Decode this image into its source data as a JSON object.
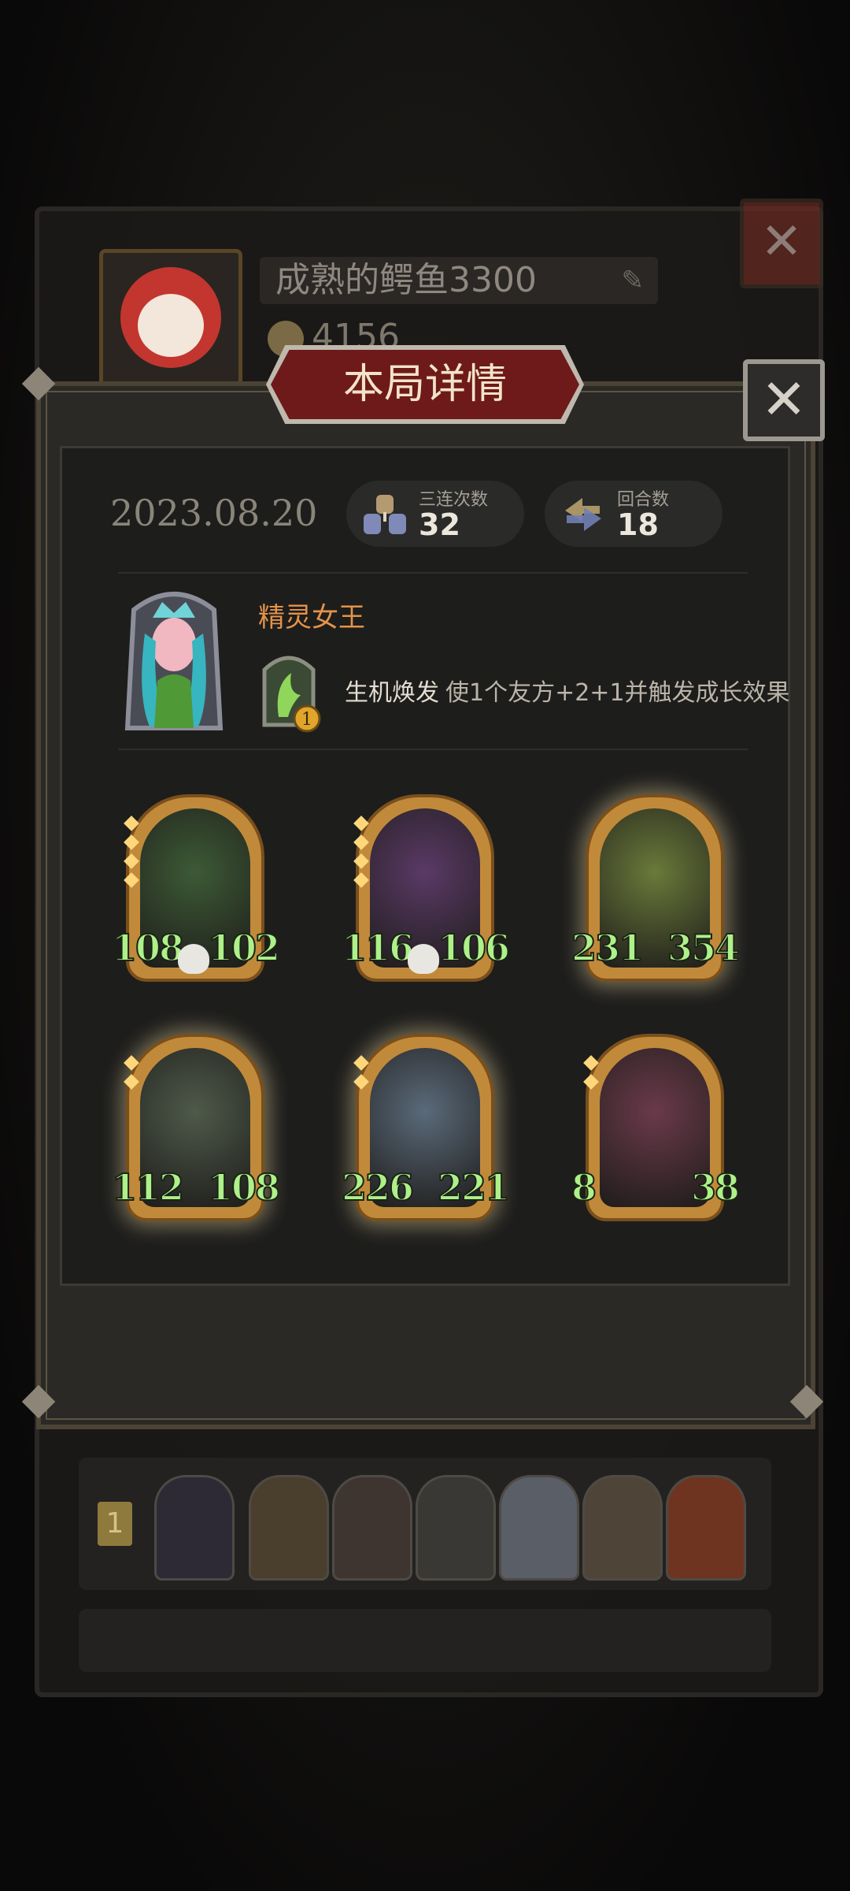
{
  "background": {
    "player_name": "成熟的鳄鱼3300",
    "coins": "4156",
    "close_label": "✕",
    "row_rank": "1"
  },
  "dialog": {
    "title": "本局详情",
    "close_label": "✕",
    "date": "2023.08.20",
    "stats": [
      {
        "label": "三连次数",
        "value": "32",
        "icon": "triple-merge-icon"
      },
      {
        "label": "回合数",
        "value": "18",
        "icon": "rounds-arrows-icon"
      }
    ],
    "hero": {
      "name": "精灵女王",
      "skill_name": "生机焕发",
      "skill_desc": "使1个友方+2+1并触发成长效果",
      "skill_cost": "1"
    },
    "cards": [
      {
        "name": "vine-crystal-plant",
        "attack": "108",
        "health": "102",
        "tier": 4,
        "skull": true,
        "glow": false,
        "art": "#3d5a36",
        "atk_disc": "#7a3fb0",
        "hp_disc": "#3a6aa8"
      },
      {
        "name": "flame-bulldog",
        "attack": "116",
        "health": "106",
        "tier": 4,
        "skull": true,
        "glow": false,
        "art": "#5a3a66",
        "atk_disc": "#335a7a",
        "hp_disc": "#7a3a3a"
      },
      {
        "name": "leaf-sprout-kid",
        "attack": "231",
        "health": "354",
        "tier": 0,
        "skull": false,
        "glow": true,
        "art": "#6a7a3a",
        "atk_disc": "#335a7a",
        "hp_disc": "#a33a4a"
      },
      {
        "name": "mushroom-spider",
        "attack": "112",
        "health": "108",
        "tier": 2,
        "skull": false,
        "glow": true,
        "art": "#4e5a4a",
        "atk_disc": "#335a7a",
        "hp_disc": "#b03a3a"
      },
      {
        "name": "armored-knight",
        "attack": "226",
        "health": "221",
        "tier": 2,
        "skull": false,
        "glow": true,
        "art": "#5a6a7a",
        "atk_disc": "#335a7a",
        "hp_disc": "#3a5a7a"
      },
      {
        "name": "jester-clown",
        "attack": "8",
        "health": "38",
        "tier": 2,
        "skull": false,
        "glow": false,
        "art": "#6a3a4a",
        "atk_disc": "#3a6aa8",
        "hp_disc": "#3a5a7a"
      }
    ]
  }
}
